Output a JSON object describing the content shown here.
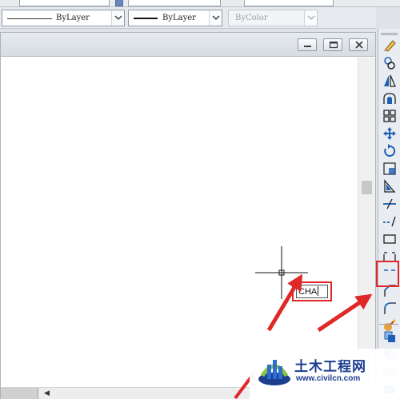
{
  "properties_toolbar": {
    "linetype": {
      "value": "ByLayer"
    },
    "lineweight": {
      "value": "ByLayer"
    },
    "plotstyle": {
      "value": "ByColor"
    }
  },
  "command": {
    "input_value": "CHA"
  },
  "tool_palette": {
    "tools": [
      {
        "name": "erase-icon"
      },
      {
        "name": "copy-icon"
      },
      {
        "name": "mirror-icon"
      },
      {
        "name": "offset-icon"
      },
      {
        "name": "array-icon"
      },
      {
        "name": "move-icon"
      },
      {
        "name": "rotate-icon"
      },
      {
        "name": "scale-icon"
      },
      {
        "name": "stretch-icon"
      },
      {
        "name": "trim-icon"
      },
      {
        "name": "extend-icon"
      },
      {
        "name": "break-at-point-icon"
      },
      {
        "name": "break-icon"
      },
      {
        "name": "join-icon"
      },
      {
        "name": "chamfer-icon"
      },
      {
        "name": "fillet-icon"
      },
      {
        "name": "explode-icon"
      }
    ]
  },
  "watermark": {
    "title": "土木工程网",
    "url": "www.civilcn.com"
  },
  "colors": {
    "annotation_red": "#e02828",
    "canvas_background": "#ffffff",
    "watermark_blue": "#1d3d8f"
  }
}
